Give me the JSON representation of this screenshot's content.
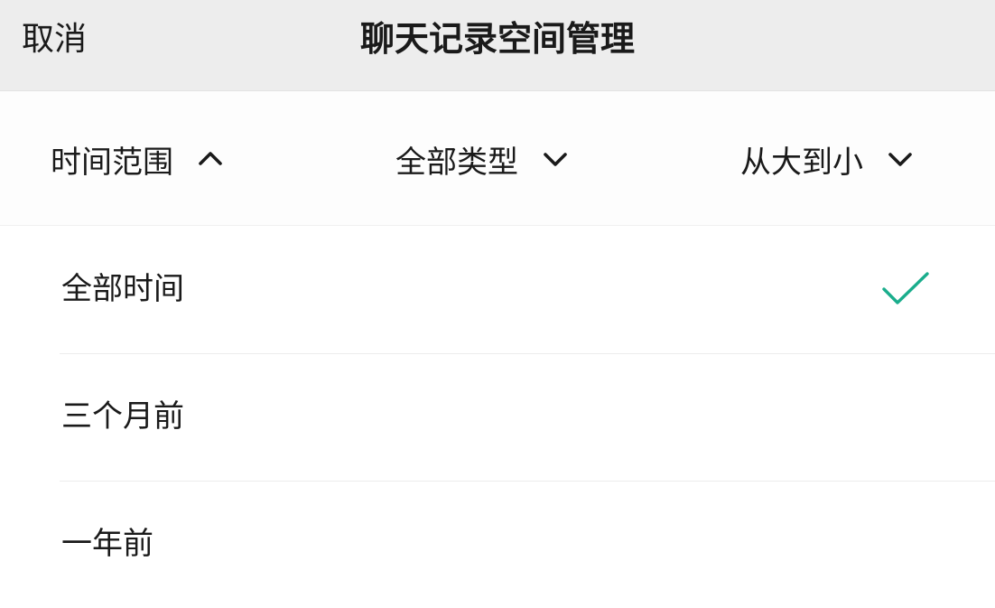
{
  "header": {
    "cancel_label": "取消",
    "title": "聊天记录空间管理"
  },
  "filters": {
    "time": {
      "label": "时间范围",
      "icon": "chevron-up-icon",
      "expanded": true
    },
    "type": {
      "label": "全部类型",
      "icon": "chevron-down-icon",
      "expanded": false
    },
    "sort": {
      "label": "从大到小",
      "icon": "chevron-down-icon",
      "expanded": false
    }
  },
  "time_options": [
    {
      "label": "全部时间",
      "selected": true
    },
    {
      "label": "三个月前",
      "selected": false
    },
    {
      "label": "一年前",
      "selected": false
    }
  ],
  "colors": {
    "accent_check": "#1aad8c",
    "header_bg": "#ededed",
    "text": "#1a1a1a"
  }
}
